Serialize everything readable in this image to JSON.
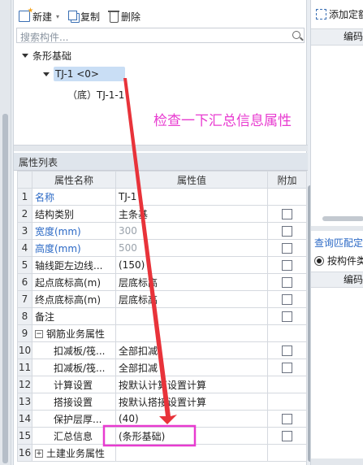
{
  "toolbar": {
    "new_label": "新建",
    "copy_label": "复制",
    "delete_label": "删除"
  },
  "search": {
    "placeholder": "搜索构件..."
  },
  "tree": {
    "root": "条形基础",
    "child": "TJ-1 <0>",
    "grandchild": "（底）TJ-1-1"
  },
  "annotation": {
    "text": "检查一下汇总信息属性",
    "color": "#e83bd0"
  },
  "properties": {
    "title": "属性列表",
    "columns": [
      "属性名称",
      "属性值",
      "附加"
    ],
    "rows": [
      {
        "num": "1",
        "name": "名称",
        "value": "TJ-1",
        "check": false
      },
      {
        "num": "2",
        "name": "结构类别",
        "value": "主条基",
        "check": true
      },
      {
        "num": "3",
        "name": "宽度(mm)",
        "value": "300",
        "check": true
      },
      {
        "num": "4",
        "name": "高度(mm)",
        "value": "500",
        "check": true
      },
      {
        "num": "5",
        "name": "轴线距左边线...",
        "value": "(150)",
        "check": true
      },
      {
        "num": "6",
        "name": "起点底标高(m)",
        "value": "层底标高",
        "check": true
      },
      {
        "num": "7",
        "name": "终点底标高(m)",
        "value": "层底标高",
        "check": true
      },
      {
        "num": "8",
        "name": "备注",
        "value": "",
        "check": true
      },
      {
        "num": "9",
        "name": "钢筋业务属性",
        "value": "",
        "check": false
      },
      {
        "num": "10",
        "name": "扣减板/筏...",
        "value": "全部扣减",
        "check": true
      },
      {
        "num": "11",
        "name": "扣减板/筏...",
        "value": "全部扣减",
        "check": true
      },
      {
        "num": "12",
        "name": "计算设置",
        "value": "按默认计算设置计算",
        "check": false
      },
      {
        "num": "13",
        "name": "搭接设置",
        "value": "按默认搭接设置计算",
        "check": false
      },
      {
        "num": "14",
        "name": "保护层厚...",
        "value": "(40)",
        "check": true
      },
      {
        "num": "15",
        "name": "汇总信息",
        "value": "(条形基础)",
        "check": true
      },
      {
        "num": "16",
        "name": "土建业务属性",
        "value": "",
        "check": false
      }
    ]
  },
  "right_panel": {
    "add_label": "添加定额",
    "code_header": "编码",
    "link_label": "查询匹配定额",
    "radio_label": "按构件类型",
    "code_header2": "编码"
  },
  "colors": {
    "highlight_box": "#e83bd0",
    "arrow": "#e8333a",
    "link_blue": "#2a68c5"
  }
}
